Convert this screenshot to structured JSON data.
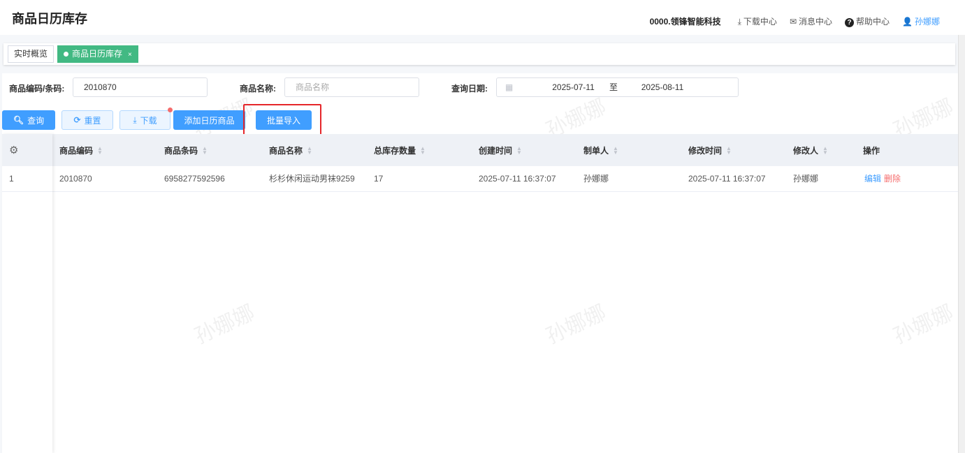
{
  "header": {
    "title": "商品日历库存",
    "company": "0000.领锋智能科技",
    "download_center": "下载中心",
    "message_center": "消息中心",
    "help_center": "帮助中心",
    "user": "孙娜娜"
  },
  "tabs": [
    {
      "label": "实时概览"
    },
    {
      "label": "商品日历库存",
      "close": "×"
    }
  ],
  "filters": {
    "code_label": "商品编码/条码:",
    "code_value": "2010870",
    "name_label": "商品名称:",
    "name_placeholder": "商品名称",
    "date_label": "查询日期:",
    "date_start": "2025-07-11",
    "date_sep": "至",
    "date_end": "2025-08-11"
  },
  "buttons": {
    "query": "查询",
    "reset": "重置",
    "download": "下载",
    "add": "添加日历商品",
    "batch_import": "批量导入"
  },
  "table": {
    "columns": [
      "商品编码",
      "商品条码",
      "商品名称",
      "总库存数量",
      "创建时间",
      "制单人",
      "修改时间",
      "修改人",
      "操作"
    ],
    "rows": [
      {
        "index": "1",
        "code": "2010870",
        "barcode": "6958277592596",
        "name": "杉杉休闲运动男袜9259",
        "qty": "17",
        "created": "2025-07-11 16:37:07",
        "creator": "孙娜娜",
        "modified": "2025-07-11 16:37:07",
        "modifier": "孙娜娜",
        "edit": "编辑",
        "delete": "删除"
      }
    ]
  },
  "watermark": "孙娜娜",
  "colors": {
    "primary": "#409eff",
    "tab_active": "#42b983",
    "danger": "#f56c6c",
    "highlight": "#e5262a"
  }
}
